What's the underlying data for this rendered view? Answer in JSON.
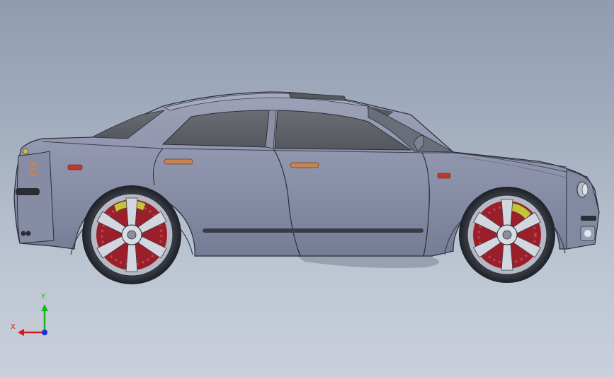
{
  "viewport": {
    "background_top": "#8f9cb0",
    "background_bottom": "#c9d0db"
  },
  "model": {
    "body_color": "#8f95ad",
    "glass_color": "#5f6268",
    "caliper_color": "#c8c23a",
    "brake_disc_color": "#9a1f2a",
    "rim_color": "#c9ccd4",
    "handle_color": "#c9834f",
    "marker_light_color": "#c0392b"
  },
  "triad": {
    "y_label": "Y",
    "x_label": "X",
    "y_color": "#1db31d",
    "x_color": "#d11b1b",
    "origin_color": "#1a2fcf"
  }
}
